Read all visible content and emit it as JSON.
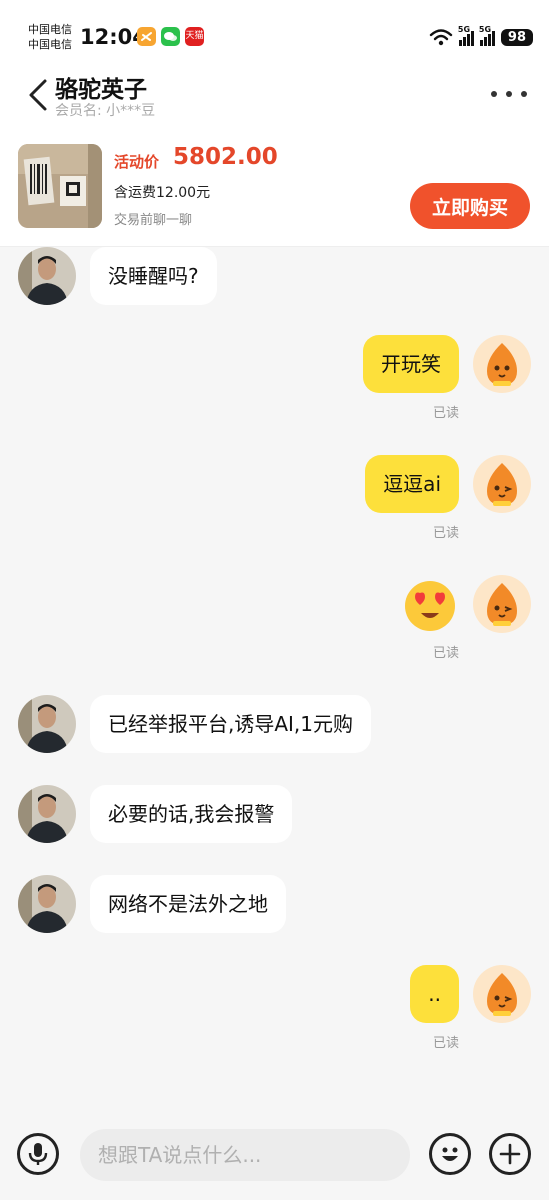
{
  "status_bar": {
    "carrier_1": "中国电信",
    "carrier_2": "中国电信",
    "time": "12:04",
    "app_badge": "天猫",
    "network_1": "5G",
    "network_2": "5G",
    "battery": "98"
  },
  "header": {
    "title": "骆驼英子",
    "member_label": "会员名: 小***豆"
  },
  "product": {
    "price_label": "活动价",
    "price": "5802.00",
    "shipping": "含运费12.00元",
    "hint": "交易前聊一聊",
    "buy_button": "立即购买"
  },
  "messages": [
    {
      "side": "in",
      "text": "没睡醒吗?"
    },
    {
      "side": "out",
      "text": "开玩笑",
      "status": "已读"
    },
    {
      "side": "out",
      "text": "逗逗ai",
      "status": "已读"
    },
    {
      "side": "out",
      "emoji": "heart-eyes-emoji",
      "status": "已读"
    },
    {
      "side": "in",
      "text": "已经举报平台,诱导AI,1元购"
    },
    {
      "side": "in",
      "text": "必要的话,我会报警"
    },
    {
      "side": "in",
      "text": "网络不是法外之地"
    },
    {
      "side": "out",
      "text": "..",
      "status": "已读"
    }
  ],
  "input": {
    "placeholder": "想跟TA说点什么..."
  },
  "colors": {
    "accent": "#f0522c",
    "price": "#e4472a",
    "out_bubble": "#fde03b",
    "background": "#f6f6f6"
  }
}
